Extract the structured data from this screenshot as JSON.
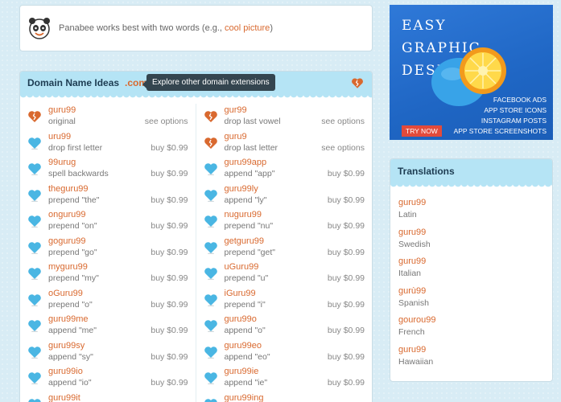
{
  "tip": {
    "prefix": "Panabee works best with two words (e.g., ",
    "link": "cool picture",
    "suffix": ")"
  },
  "ideas": {
    "title": "Domain Name Ideas",
    "tld": ".com",
    "tooltip": "Explore other domain extensions",
    "left": [
      {
        "name": "guru99",
        "desc": "original",
        "price": "see options",
        "icon": "broken-heart-icon"
      },
      {
        "name": "uru99",
        "desc": "drop first letter",
        "price": "buy $0.99",
        "icon": "heart-icon"
      },
      {
        "name": "99urug",
        "desc": "spell backwards",
        "price": "buy $0.99",
        "icon": "heart-icon"
      },
      {
        "name": "theguru99",
        "desc": "prepend \"the\"",
        "price": "buy $0.99",
        "icon": "heart-icon"
      },
      {
        "name": "onguru99",
        "desc": "prepend \"on\"",
        "price": "buy $0.99",
        "icon": "heart-icon"
      },
      {
        "name": "goguru99",
        "desc": "prepend \"go\"",
        "price": "buy $0.99",
        "icon": "heart-icon"
      },
      {
        "name": "myguru99",
        "desc": "prepend \"my\"",
        "price": "buy $0.99",
        "icon": "heart-icon"
      },
      {
        "name": "oGuru99",
        "desc": "prepend \"o\"",
        "price": "buy $0.99",
        "icon": "heart-icon"
      },
      {
        "name": "guru99me",
        "desc": "append \"me\"",
        "price": "buy $0.99",
        "icon": "heart-icon"
      },
      {
        "name": "guru99sy",
        "desc": "append \"sy\"",
        "price": "buy $0.99",
        "icon": "heart-icon"
      },
      {
        "name": "guru99io",
        "desc": "append \"io\"",
        "price": "buy $0.99",
        "icon": "heart-icon"
      },
      {
        "name": "guru99it",
        "desc": "",
        "price": "",
        "icon": "heart-icon"
      }
    ],
    "right": [
      {
        "name": "gur99",
        "desc": "drop last vowel",
        "price": "see options",
        "icon": "broken-heart-icon"
      },
      {
        "name": "guru9",
        "desc": "drop last letter",
        "price": "see options",
        "icon": "broken-heart-icon"
      },
      {
        "name": "guru99app",
        "desc": "append \"app\"",
        "price": "buy $0.99",
        "icon": "heart-icon"
      },
      {
        "name": "guru99ly",
        "desc": "append \"ly\"",
        "price": "buy $0.99",
        "icon": "heart-icon"
      },
      {
        "name": "nuguru99",
        "desc": "prepend \"nu\"",
        "price": "buy $0.99",
        "icon": "heart-icon"
      },
      {
        "name": "getguru99",
        "desc": "prepend \"get\"",
        "price": "buy $0.99",
        "icon": "heart-icon"
      },
      {
        "name": "uGuru99",
        "desc": "prepend \"u\"",
        "price": "buy $0.99",
        "icon": "heart-icon"
      },
      {
        "name": "iGuru99",
        "desc": "prepend \"i\"",
        "price": "buy $0.99",
        "icon": "heart-icon"
      },
      {
        "name": "guru99o",
        "desc": "append \"o\"",
        "price": "buy $0.99",
        "icon": "heart-icon"
      },
      {
        "name": "guru99eo",
        "desc": "append \"eo\"",
        "price": "buy $0.99",
        "icon": "heart-icon"
      },
      {
        "name": "guru99ie",
        "desc": "append \"ie\"",
        "price": "buy $0.99",
        "icon": "heart-icon"
      },
      {
        "name": "guru99ing",
        "desc": "",
        "price": "",
        "icon": "heart-icon"
      }
    ]
  },
  "ad": {
    "title_lines": [
      "EASY",
      "GRAPHIC",
      "DESIGN"
    ],
    "features": [
      "FACEBOOK ADS",
      "APP STORE ICONS",
      "INSTAGRAM POSTS",
      "APP STORE SCREENSHOTS"
    ],
    "button": "TRY NOW"
  },
  "translations": {
    "title": "Translations",
    "items": [
      {
        "name": "guru99",
        "lang": "Latin"
      },
      {
        "name": "guru99",
        "lang": "Swedish"
      },
      {
        "name": "guru99",
        "lang": "Italian"
      },
      {
        "name": "gurù99",
        "lang": "Spanish"
      },
      {
        "name": "gourou99",
        "lang": "French"
      },
      {
        "name": "guru99",
        "lang": "Hawaiian"
      }
    ]
  },
  "colors": {
    "accent": "#d9692f",
    "heart": "#4ab6e3",
    "header": "#b5e4f5"
  }
}
